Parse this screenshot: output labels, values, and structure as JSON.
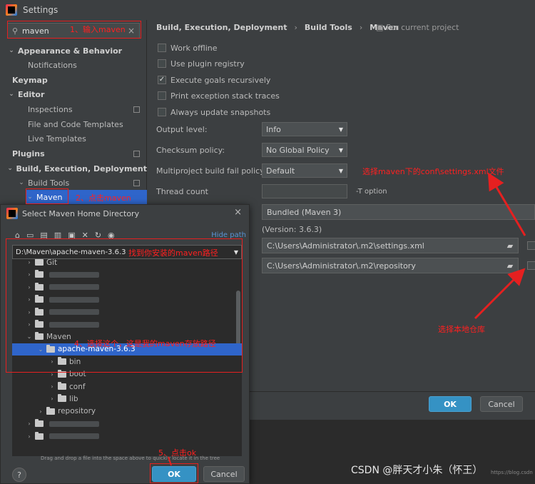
{
  "window": {
    "title": "Settings"
  },
  "sidebar": {
    "search_value": "maven",
    "items": [
      {
        "label": "Appearance & Behavior",
        "level": 0,
        "bold": true,
        "expanded": true
      },
      {
        "label": "Notifications",
        "level": 1
      },
      {
        "label": "Keymap",
        "level": 0,
        "bold": true
      },
      {
        "label": "Editor",
        "level": 0,
        "bold": true,
        "expanded": true
      },
      {
        "label": "Inspections",
        "level": 1,
        "project": true
      },
      {
        "label": "File and Code Templates",
        "level": 1
      },
      {
        "label": "Live Templates",
        "level": 1
      },
      {
        "label": "Plugins",
        "level": 0,
        "bold": true,
        "project": true
      },
      {
        "label": "Build, Execution, Deployment",
        "level": 0,
        "bold": true,
        "expanded": true
      },
      {
        "label": "Build Tools",
        "level": 1,
        "expanded": true,
        "project": true
      },
      {
        "label": "Maven",
        "level": 2,
        "selected": true
      }
    ]
  },
  "main": {
    "breadcrumb": [
      "Build, Execution, Deployment",
      "Build Tools",
      "Maven"
    ],
    "for_project": "For current project",
    "checkboxes": [
      {
        "label": "Work offline",
        "checked": false
      },
      {
        "label": "Use plugin registry",
        "checked": false
      },
      {
        "label": "Execute goals recursively",
        "checked": true
      },
      {
        "label": "Print exception stack traces",
        "checked": false
      },
      {
        "label": "Always update snapshots",
        "checked": false
      }
    ],
    "output_level": {
      "label": "Output level:",
      "value": "Info"
    },
    "checksum_policy": {
      "label": "Checksum policy:",
      "value": "No Global Policy"
    },
    "fail_policy": {
      "label": "Multiproject build fail policy:",
      "value": "Default"
    },
    "thread_count": {
      "label": "Thread count",
      "suffix": "-T option"
    },
    "maven_home": "Bundled (Maven 3)",
    "version": "(Version: 3.6.3)",
    "settings_file": "C:\\Users\\Administrator\\.m2\\settings.xml",
    "local_repo": "C:\\Users\\Administrator\\.m2\\repository",
    "ok_label": "OK",
    "cancel_label": "Cancel"
  },
  "dialog": {
    "title": "Select Maven Home Directory",
    "hide_path": "Hide path",
    "path": "D:\\Maven\\apache-maven-3.6.3",
    "tree": [
      {
        "label": "Git",
        "indent": 1,
        "chev": "›"
      },
      {
        "label": "",
        "indent": 1,
        "chev": "›",
        "blurred": true
      },
      {
        "label": "",
        "indent": 1,
        "chev": "›",
        "blurred": true
      },
      {
        "label": "",
        "indent": 1,
        "chev": "›",
        "blurred": true
      },
      {
        "label": "",
        "indent": 1,
        "chev": "›",
        "blurred": true
      },
      {
        "label": "",
        "indent": 1,
        "chev": "›",
        "blurred": true
      },
      {
        "label": "Maven",
        "indent": 1,
        "chev": "⌄"
      },
      {
        "label": "apache-maven-3.6.3",
        "indent": 2,
        "chev": "⌄",
        "selected": true
      },
      {
        "label": "bin",
        "indent": 3,
        "chev": "›"
      },
      {
        "label": "boot",
        "indent": 3,
        "chev": "›"
      },
      {
        "label": "conf",
        "indent": 3,
        "chev": "›"
      },
      {
        "label": "lib",
        "indent": 3,
        "chev": "›"
      },
      {
        "label": "repository",
        "indent": 2,
        "chev": "›"
      },
      {
        "label": "",
        "indent": 1,
        "chev": "›",
        "blurred": true
      },
      {
        "label": "",
        "indent": 1,
        "chev": "›",
        "blurred": true
      }
    ],
    "hint": "Drag and drop a file into the space above to quickly locate it in the tree",
    "ok_label": "OK",
    "cancel_label": "Cancel",
    "help": "?"
  },
  "annotations": {
    "step1": "1、输入maven",
    "step2": "2、点击maven",
    "step3": "找到你安装的maven路径",
    "step4": "4、选择这个，这是我的maven存放路径",
    "step5": "5、点击ok",
    "settings_hint": "选择maven下的conf\\settings.xml文件",
    "repo_hint": "选择本地仓库"
  },
  "watermark": "CSDN @胖天才小朱（怀王）",
  "watermark_small": "https://blog.csdn",
  "colors": {
    "accent_blue": "#2f65ca",
    "annotation_red": "#e52020",
    "ok_blue": "#3592c4"
  }
}
